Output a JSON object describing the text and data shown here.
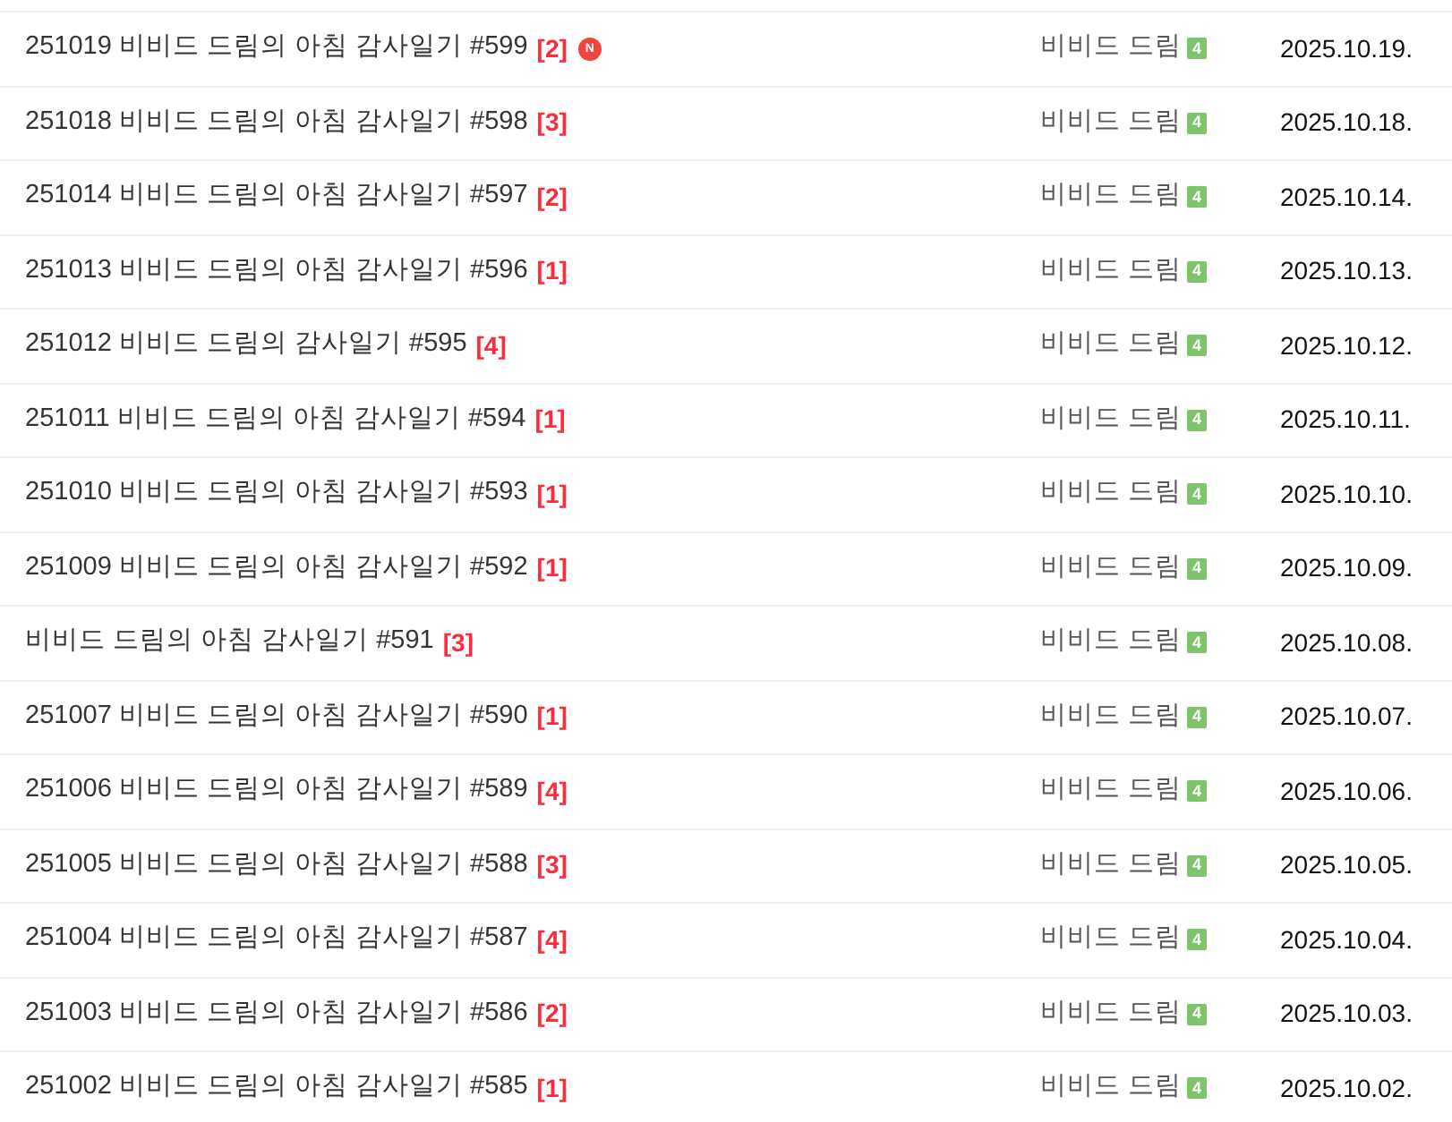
{
  "posts": [
    {
      "title": "251019 비비드 드림의 아침 감사일기 #599",
      "comments": "[2]",
      "new_badge": "N",
      "author": "비비드 드림",
      "author_level": "4",
      "date": "2025.10.19."
    },
    {
      "title": "251018 비비드 드림의 아침 감사일기 #598",
      "comments": "[3]",
      "author": "비비드 드림",
      "author_level": "4",
      "date": "2025.10.18."
    },
    {
      "title": "251014 비비드 드림의 아침 감사일기 #597",
      "comments": "[2]",
      "author": "비비드 드림",
      "author_level": "4",
      "date": "2025.10.14."
    },
    {
      "title": "251013 비비드 드림의 아침 감사일기 #596",
      "comments": "[1]",
      "author": "비비드 드림",
      "author_level": "4",
      "date": "2025.10.13."
    },
    {
      "title": "251012 비비드 드림의 감사일기 #595",
      "comments": "[4]",
      "author": "비비드 드림",
      "author_level": "4",
      "date": "2025.10.12."
    },
    {
      "title": "251011 비비드 드림의 아침 감사일기 #594",
      "comments": "[1]",
      "author": "비비드 드림",
      "author_level": "4",
      "date": "2025.10.11."
    },
    {
      "title": "251010 비비드 드림의 아침 감사일기 #593",
      "comments": "[1]",
      "author": "비비드 드림",
      "author_level": "4",
      "date": "2025.10.10."
    },
    {
      "title": "251009 비비드 드림의 아침 감사일기 #592",
      "comments": "[1]",
      "author": "비비드 드림",
      "author_level": "4",
      "date": "2025.10.09."
    },
    {
      "title": "비비드 드림의 아침 감사일기 #591",
      "comments": "[3]",
      "author": "비비드 드림",
      "author_level": "4",
      "date": "2025.10.08."
    },
    {
      "title": "251007 비비드 드림의 아침 감사일기 #590",
      "comments": "[1]",
      "author": "비비드 드림",
      "author_level": "4",
      "date": "2025.10.07."
    },
    {
      "title": "251006 비비드 드림의 아침 감사일기 #589",
      "comments": "[4]",
      "author": "비비드 드림",
      "author_level": "4",
      "date": "2025.10.06."
    },
    {
      "title": "251005 비비드 드림의 아침 감사일기 #588",
      "comments": "[3]",
      "author": "비비드 드림",
      "author_level": "4",
      "date": "2025.10.05."
    },
    {
      "title": "251004 비비드 드림의 아침 감사일기 #587",
      "comments": "[4]",
      "author": "비비드 드림",
      "author_level": "4",
      "date": "2025.10.04."
    },
    {
      "title": "251003 비비드 드림의 아침 감사일기 #586",
      "comments": "[2]",
      "author": "비비드 드림",
      "author_level": "4",
      "date": "2025.10.03."
    },
    {
      "title": "251002 비비드 드림의 아침 감사일기 #585",
      "comments": "[1]",
      "author": "비비드 드림",
      "author_level": "4",
      "date": "2025.10.02."
    }
  ]
}
